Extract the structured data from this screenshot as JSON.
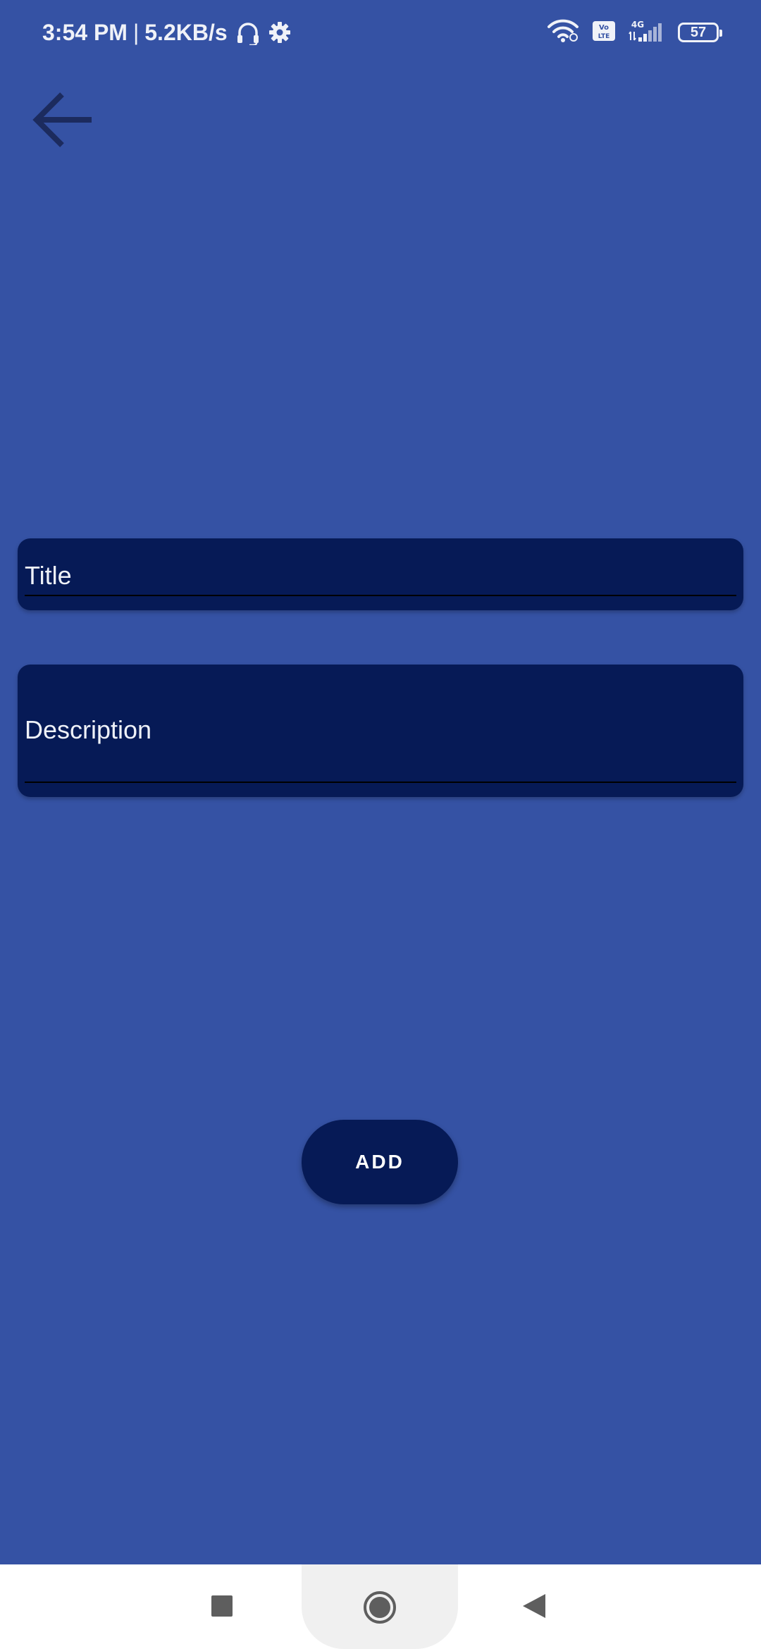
{
  "status_bar": {
    "time": "3:54 PM",
    "separator": "|",
    "network_speed": "5.2KB/s",
    "left_icons": [
      "headset-icon",
      "settings-icon"
    ],
    "right_icons": [
      "wifi-icon",
      "volte-icon",
      "signal-4g-icon",
      "battery-icon"
    ],
    "volte_label": "Vo LTE",
    "network_type": "4G",
    "battery_level": "57"
  },
  "toolbar": {
    "back_icon": "arrow-left-icon"
  },
  "form": {
    "title_placeholder": "Title",
    "description_placeholder": "Description",
    "add_label": "ADD"
  },
  "nav_bar": {
    "items": [
      "recents-button",
      "home-button",
      "back-button"
    ]
  },
  "colors": {
    "background": "#3552A4",
    "field_background": "#061A56",
    "button_background": "#061A56",
    "back_arrow": "#1C2B5E",
    "nav_background": "#FFFFFF",
    "nav_icons": "#5E5E5E"
  }
}
